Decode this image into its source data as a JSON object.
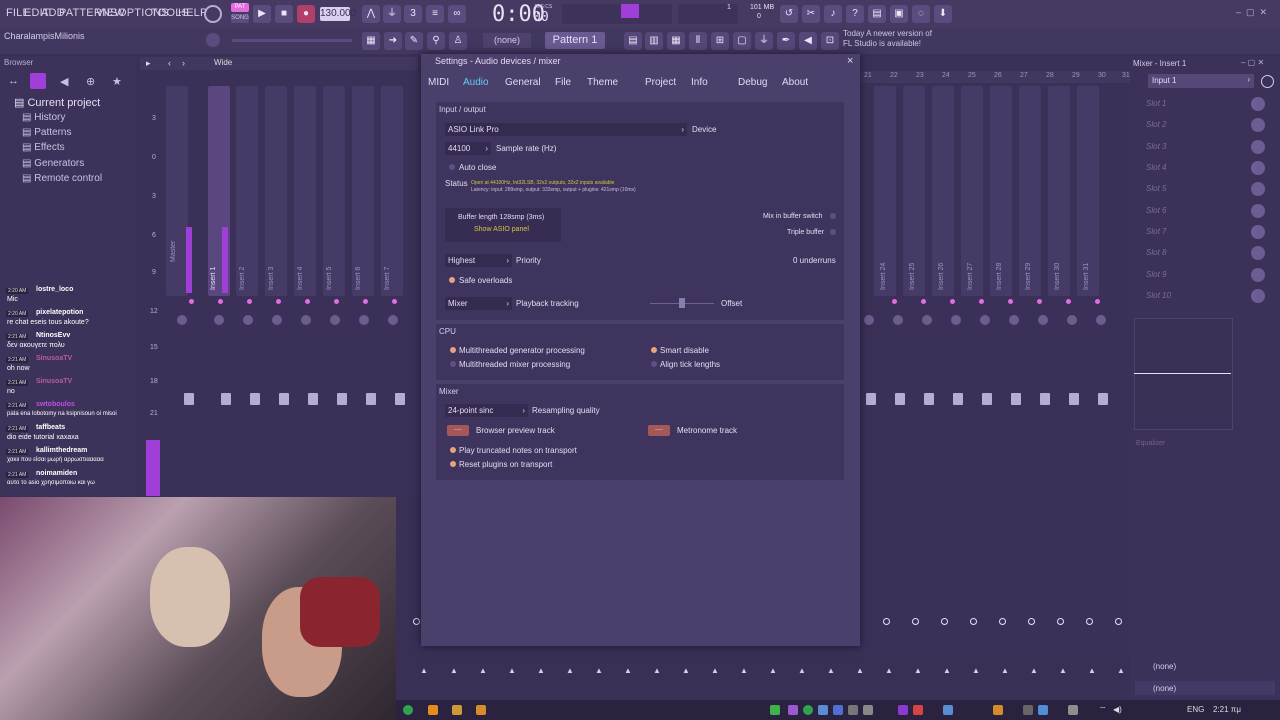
{
  "menu": [
    "FILE",
    "EDIT",
    "ADD",
    "PATTERNS",
    "VIEW",
    "OPTIONS",
    "TOOLS",
    "HELP"
  ],
  "transport": {
    "tempo": "130.000",
    "time": "0:00",
    "time_sub": "00",
    "time_label": "M:S:CS",
    "pat_label": "PAT",
    "song_label": "SONG",
    "cpu_value": "1",
    "cpu_sub": "0",
    "mem_value": "101 MB",
    "mem_sub": "0"
  },
  "project_name": "CharalampisMilionis",
  "toolbar2": {
    "none_label": "(none)",
    "pattern_label": "Pattern 1",
    "news_line1": "Today  A newer version of",
    "news_line2": "FL Studio is available!"
  },
  "browser": {
    "title": "Browser",
    "top": "Current project",
    "items": [
      "History",
      "Patterns",
      "Effects",
      "Generators",
      "Remote control"
    ]
  },
  "channel_rack": {
    "mode": "Wide",
    "scale": [
      "3",
      "0",
      "3",
      "6",
      "9",
      "12",
      "15",
      "18",
      "21"
    ],
    "strips": [
      "Master",
      "Insert 1",
      "Insert 2",
      "Insert 3",
      "Insert 4",
      "Insert 5",
      "Insert 6",
      "Insert 7"
    ]
  },
  "right_strips": [
    "Insert 24",
    "Insert 25",
    "Insert 26",
    "Insert 27",
    "Insert 28",
    "Insert 29",
    "Insert 30",
    "Insert 31"
  ],
  "right_ruler": [
    "21",
    "22",
    "23",
    "24",
    "25",
    "26",
    "27",
    "28",
    "29",
    "30",
    "31"
  ],
  "chat": [
    {
      "time": "2:20 AM",
      "user": "lostre_loco",
      "msg": "Mic"
    },
    {
      "time": "2:20 AM",
      "user": "pixelatepotion",
      "msg": "re chat eseis tous akoute?"
    },
    {
      "time": "2:21 AM",
      "user": "NtinosEvv",
      "msg": "δεν ακουγετε πολυ"
    },
    {
      "time": "2:21 AM",
      "user": "SinusoaTV",
      "msg": "oh now"
    },
    {
      "time": "2:21 AM",
      "user": "SinusoaTV",
      "msg": "no"
    },
    {
      "time": "2:21 AM",
      "user": "swtoboulos",
      "msg": "pata ena lobotomy na ksipnisoun oi misoi"
    },
    {
      "time": "2:21 AM",
      "user": "taffbeats",
      "msg": "dio eide tutorial xaxaxa"
    },
    {
      "time": "2:21 AM",
      "user": "kallimthedream",
      "msg": "χακιι πoυ είσαι μωρή αρρωστιααααα"
    },
    {
      "time": "2:21 AM",
      "user": "noimamiden",
      "msg": "αυτο το asio χρησιμοποιω και γω"
    }
  ],
  "dialog": {
    "title": "Settings - Audio devices / mixer",
    "close": "×",
    "tabs": [
      "MIDI",
      "Audio",
      "General",
      "File",
      "Theme",
      "Project",
      "Info",
      "Debug",
      "About"
    ],
    "active_tab": "Audio",
    "io": {
      "section": "Input / output",
      "device_value": "ASIO Link Pro",
      "device_label": "Device",
      "rate_value": "44100",
      "rate_label": "Sample rate (Hz)",
      "auto_close": "Auto close",
      "status_label": "Status",
      "status_line1": "Open at 44100Hz, Int32LSB, 32x2 outputs, 32x2 inputs available",
      "status_line2": "Latency: input: 289smp, output: 333smp, output + plugins: 421smp (10ms)",
      "buffer_label": "Buffer length 128smp (3ms)",
      "asio_panel": "Show ASIO panel",
      "mix_switch": "Mix in buffer switch",
      "triple_buffer": "Triple buffer",
      "priority_value": "Highest",
      "priority_label": "Priority",
      "underruns": "0 underruns",
      "safe_overloads": "Safe overloads",
      "tracking_value": "Mixer",
      "tracking_label": "Playback tracking",
      "offset_label": "Offset"
    },
    "cpu": {
      "section": "CPU",
      "gen_proc": "Multithreaded generator processing",
      "mix_proc": "Multithreaded mixer processing",
      "smart_disable": "Smart disable",
      "align_tick": "Align tick lengths"
    },
    "mixer": {
      "section": "Mixer",
      "quality_value": "24-point sinc",
      "quality_label": "Resampling quality",
      "browser_track": "Browser preview track",
      "metronome_track": "Metronome track",
      "track_btn": "----",
      "truncated": "Play truncated notes on transport",
      "reset_plugins": "Reset plugins on transport"
    }
  },
  "mixer_panel": {
    "title": "Mixer - Insert 1",
    "input": "Input 1",
    "slots": [
      "Slot 1",
      "Slot 2",
      "Slot 3",
      "Slot 4",
      "Slot 5",
      "Slot 6",
      "Slot 7",
      "Slot 8",
      "Slot 9",
      "Slot 10"
    ],
    "eq_label": "Equalizer",
    "none1": "(none)",
    "none2": "(none)"
  },
  "taskbar": {
    "lang": "ENG",
    "clock": "2:21 πμ"
  },
  "colors": {
    "bg": "#3a2f55",
    "accent": "#5fd0ef",
    "active": "#e46be0"
  }
}
